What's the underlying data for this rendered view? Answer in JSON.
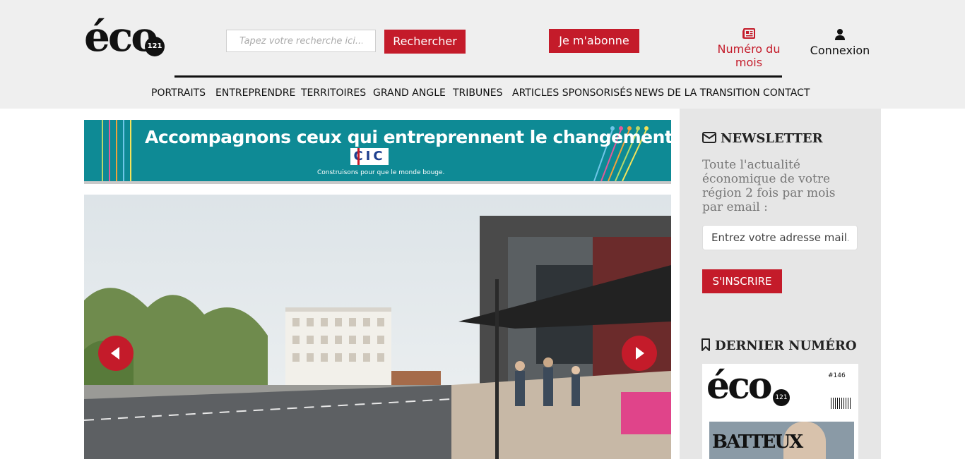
{
  "header": {
    "logo_text": "éco",
    "logo_badge": "121",
    "search_placeholder": "Tapez votre recherche ici...",
    "search_button": "Rechercher",
    "subscribe_button": "Je m'abonne",
    "issue_link": "Numéro du mois",
    "login_link": "Connexion"
  },
  "nav": {
    "items": [
      "PORTRAITS",
      "ENTREPRENDRE",
      "TERRITOIRES",
      "GRAND ANGLE",
      "TRIBUNES",
      "ARTICLES SPONSORISÉS",
      "NEWS DE LA TRANSITION",
      "CONTACT"
    ]
  },
  "banner": {
    "headline": "Accompagnons ceux qui entreprennent le changement.",
    "brand": "CIC",
    "tagline": "Construisons pour que le monde bouge."
  },
  "sidebar": {
    "newsletter_title": "NEWSLETTER",
    "newsletter_desc": "Toute l'actualité économique de votre région 2 fois par mois par email :",
    "email_placeholder": "Entrez votre adresse mail.",
    "subscribe_button": "S'INSCRIRE",
    "latest_issue_title": "DERNIER NUMÉRO",
    "cover_logo": "éco",
    "cover_badge": "121",
    "cover_issue": "#146",
    "cover_headline": "BATTEUX"
  },
  "colors": {
    "accent_red": "#c41b2a",
    "header_bg": "#efefef",
    "sidebar_bg": "#e6e6e6",
    "banner_teal": "#0e8a95"
  }
}
